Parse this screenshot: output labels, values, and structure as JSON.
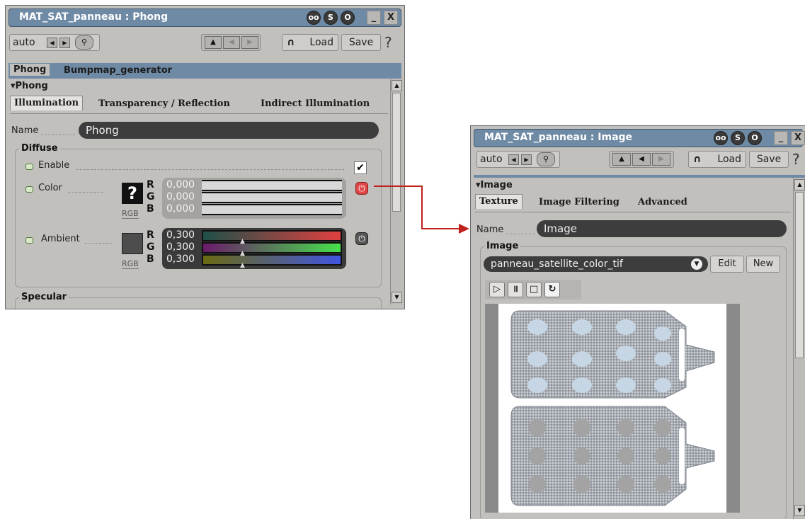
{
  "panel1": {
    "title": "MAT_SAT_panneau : Phong",
    "toolbar": {
      "auto_label": "auto",
      "load_label": "Load",
      "save_label": "Save",
      "help_label": "?"
    },
    "tabs": [
      "Phong",
      "Bumpmap_generator"
    ],
    "section": "Phong",
    "subtabs": [
      "Illumination",
      "Transparency / Reflection",
      "Indirect Illumination"
    ],
    "name_label": "Name",
    "name_value": "Phong",
    "diffuse": {
      "title": "Diffuse",
      "enable_label": "Enable",
      "color_label": "Color",
      "color_swatch_glyph": "?",
      "color_mode": "RGB",
      "color_channels": [
        {
          "ch": "R",
          "value": "0,000"
        },
        {
          "ch": "G",
          "value": "0,000"
        },
        {
          "ch": "B",
          "value": "0,000"
        }
      ],
      "ambient_label": "Ambient",
      "ambient_mode": "RGB",
      "ambient_channels": [
        {
          "ch": "R",
          "value": "0,300"
        },
        {
          "ch": "G",
          "value": "0,300"
        },
        {
          "ch": "B",
          "value": "0,300"
        }
      ]
    },
    "specular_title": "Specular"
  },
  "panel2": {
    "title": "MAT_SAT_panneau : Image",
    "toolbar": {
      "auto_label": "auto",
      "load_label": "Load",
      "save_label": "Save",
      "help_label": "?"
    },
    "section": "Image",
    "subtabs": [
      "Texture",
      "Image Filtering",
      "Advanced"
    ],
    "name_label": "Name",
    "name_value": "Image",
    "group_title": "Image",
    "image_select": "panneau_satellite_color_tif",
    "edit_label": "Edit",
    "new_label": "New"
  },
  "colors": {
    "titlebar": "#6f8aa5",
    "panel_bg": "#c2c0bd",
    "link_arrow": "#c0201a"
  }
}
